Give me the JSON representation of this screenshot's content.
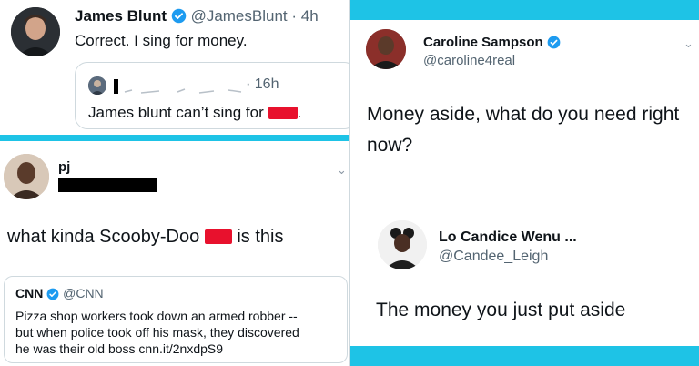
{
  "colors": {
    "accent_bar": "#1ec3e6",
    "verified": "#1d9bf0",
    "redaction_red": "#e8112d"
  },
  "tweet_blunt": {
    "name": "James Blunt",
    "handle": "@JamesBlunt",
    "time": "· 4h",
    "text": "Correct. I sing for money.",
    "quote": {
      "time": "· 16h",
      "text": "James blunt can’t sing for",
      "trailing": "."
    }
  },
  "tweet_pj": {
    "name": "pj",
    "text_before": "what kinda Scooby-Doo",
    "text_after": "is this",
    "quote": {
      "name": "CNN",
      "handle": "@CNN",
      "lines": [
        "Pizza shop workers took down an armed robber --",
        "but when police took off his mask, they discovered",
        "he was their old boss cnn.it/2nxdpS9"
      ]
    }
  },
  "tweet_caroline": {
    "name": "Caroline Sampson",
    "handle": "@caroline4real",
    "lines": [
      "Money aside, what do you need right",
      "now?"
    ]
  },
  "reply_lo": {
    "name": "Lo Candice Wenu ...",
    "handle": "@Candee_Leigh",
    "text": "The money you just put aside"
  }
}
